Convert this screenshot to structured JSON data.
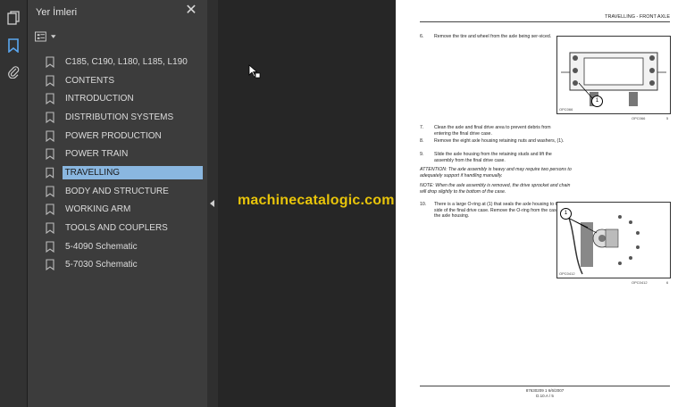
{
  "sidebar": {
    "title": "Yer İmleri",
    "bookmarks": [
      {
        "label": "C185, C190, L180, L185, L190"
      },
      {
        "label": "CONTENTS"
      },
      {
        "label": "INTRODUCTION"
      },
      {
        "label": "DISTRIBUTION SYSTEMS"
      },
      {
        "label": "POWER PRODUCTION"
      },
      {
        "label": "POWER TRAIN"
      },
      {
        "label": "TRAVELLING"
      },
      {
        "label": "BODY AND STRUCTURE"
      },
      {
        "label": "WORKING ARM"
      },
      {
        "label": "TOOLS AND COUPLERS"
      },
      {
        "label": "5-4090 Schematic"
      },
      {
        "label": "5-7030 Schematic"
      }
    ],
    "selected_index": 6,
    "selection_color": "#8ab7e0"
  },
  "toolstrip": {
    "icons": [
      "pages-icon",
      "bookmark-icon",
      "attachment-icon"
    ],
    "active_color": "#5aa7f0"
  },
  "watermark": {
    "text": "machinecatalogic.com",
    "color": "#e8c40a"
  },
  "document": {
    "header": "TRAVELLING - FRONT AXLE",
    "steps": [
      {
        "num": "6.",
        "text": "Remove the tire and wheel from the axle being ser-viced."
      },
      {
        "num": "7.",
        "text": "Clean the axle and final drive area to prevent debris from entering the final drive case."
      },
      {
        "num": "8.",
        "text": "Remove the eight axle housing retaining nuts and washers, (1)."
      },
      {
        "num": "9.",
        "text": "Slide the axle housing from the retaining studs and lift the assembly from the final drive case."
      },
      {
        "num": "10.",
        "text": "There is a large O-ring at (1) that seals the axle housing to the side of the final drive case. Remove the O-ring from the case or the axle housing."
      }
    ],
    "notes": [
      "ATTENTION: The axle assembly is heavy and may require two persons to adequately support if handling manually.",
      "NOTE: When the axle assembly is removed, the drive sprocket and chain will drop slightly to the bottom of the case."
    ],
    "figures": [
      {
        "code": "OPC066",
        "caption": "OPC066",
        "num": "5",
        "callout": "1"
      },
      {
        "code": "OPC0412",
        "caption": "OPC0412",
        "num": "6",
        "callout": "1"
      }
    ],
    "footer_line1": "87630209 1 6/6/2007",
    "footer_line2": "D.10.A / 5"
  }
}
